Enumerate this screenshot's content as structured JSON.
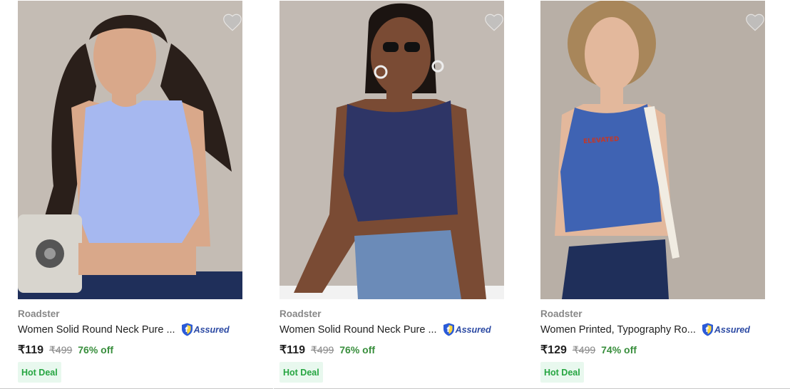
{
  "products": [
    {
      "brand": "Roadster",
      "title": "Women Solid Round Neck Pure ...",
      "assured": "Assured",
      "price": "₹119",
      "mrp": "₹499",
      "discount": "76% off",
      "badge": "Hot Deal",
      "image_icon": "model-in-light-blue-crop-top",
      "top_color": "#a6b8f0"
    },
    {
      "brand": "Roadster",
      "title": "Women Solid Round Neck Pure ...",
      "assured": "Assured",
      "price": "₹119",
      "mrp": "₹499",
      "discount": "76% off",
      "badge": "Hot Deal",
      "image_icon": "model-in-navy-crop-top",
      "top_color": "#2e3566"
    },
    {
      "brand": "Roadster",
      "title": "Women Printed, Typography Ro...",
      "assured": "Assured",
      "price": "₹129",
      "mrp": "₹499",
      "discount": "74% off",
      "badge": "Hot Deal",
      "image_icon": "model-in-blue-crop-top",
      "top_color": "#3f63b3"
    }
  ],
  "icons": {
    "wishlist": "heart-icon",
    "assured": "flipkart-assured-shield-icon"
  },
  "colors": {
    "price_off": "#388e3c",
    "hot_deal_bg": "#e8f8ee",
    "hot_deal_text": "#26a541",
    "assured": "#2b49a3"
  }
}
